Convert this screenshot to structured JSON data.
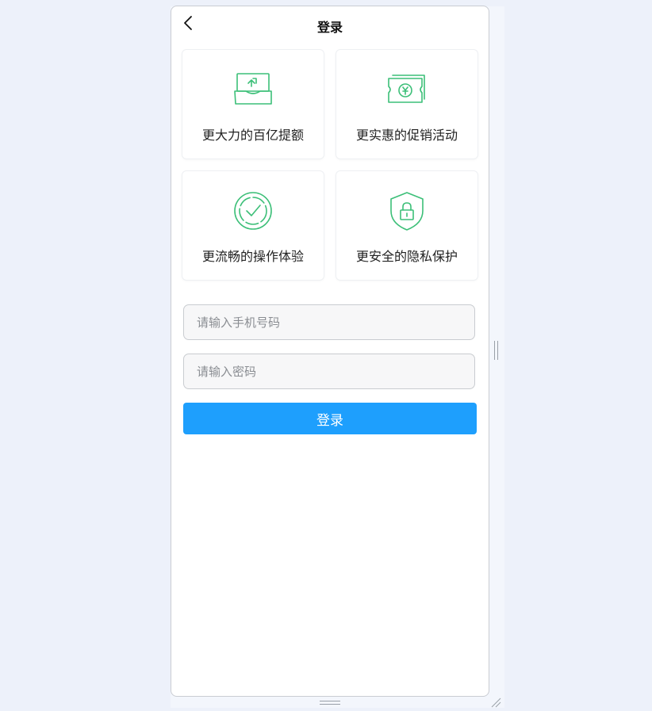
{
  "header": {
    "title": "登录",
    "back_icon": "chevron-left-icon"
  },
  "features": [
    {
      "label": "更大力的百亿提额",
      "icon": "wallet-arrow-icon"
    },
    {
      "label": "更实惠的促销活动",
      "icon": "coupon-yen-icon"
    },
    {
      "label": "更流畅的操作体验",
      "icon": "check-circle-icon"
    },
    {
      "label": "更安全的隐私保护",
      "icon": "shield-lock-icon"
    }
  ],
  "form": {
    "phone_placeholder": "请输入手机号码",
    "password_placeholder": "请输入密码",
    "submit_label": "登录"
  },
  "colors": {
    "accent": "#1e9ffd",
    "icon_green": "#3cbf78",
    "page_bg": "#edf1fa"
  }
}
